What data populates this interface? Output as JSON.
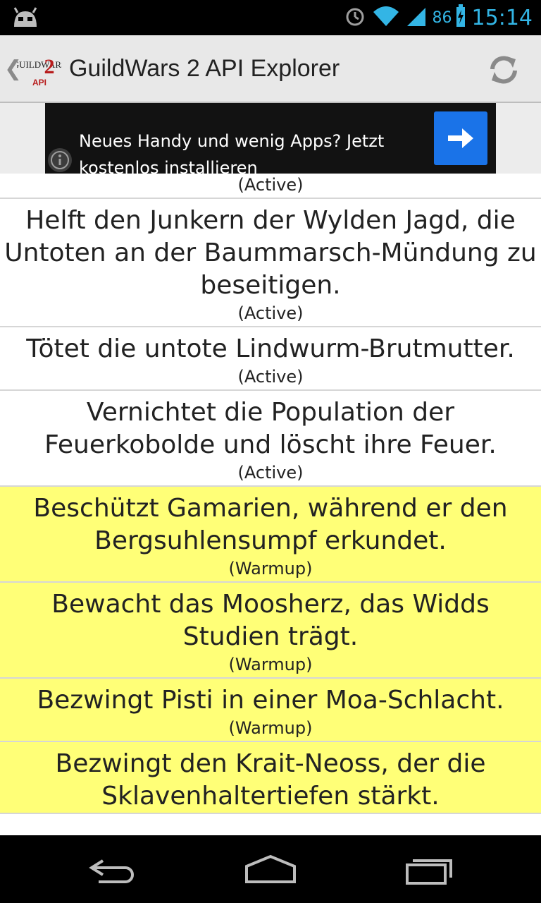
{
  "status_bar": {
    "battery": "86",
    "time": "15:14",
    "icons": [
      "android-robot-icon",
      "alarm-icon",
      "wifi-icon",
      "cell-signal-icon",
      "battery-charging-icon"
    ]
  },
  "action_bar": {
    "title": "GuildWars 2 API Explorer",
    "logo_text": "API",
    "up_icon": "chevron-left-icon",
    "refresh_icon": "refresh-icon"
  },
  "ad": {
    "text_line1": "Neues Handy und wenig Apps? Jetzt",
    "text_line2": "kostenlos installieren",
    "info_icon": "info-icon",
    "arrow_icon": "arrow-right-icon"
  },
  "colors": {
    "accent_blue": "#33b5e5",
    "warmup_bg": "#ffff77",
    "ad_button": "#1a73e8"
  },
  "events": [
    {
      "title": "",
      "status": "(Active)",
      "state": "active",
      "partial": true
    },
    {
      "title": "Helft den Junkern der Wylden Jagd, die Untoten an der Baummarsch-Mündung zu beseitigen.",
      "status": "(Active)",
      "state": "active"
    },
    {
      "title": "Tötet die untote Lindwurm-Brutmutter.",
      "status": "(Active)",
      "state": "active"
    },
    {
      "title": "Vernichtet die Population der Feuerkobolde und löscht ihre Feuer.",
      "status": "(Active)",
      "state": "active"
    },
    {
      "title": "Beschützt Gamarien, während er den Bergsuhlensumpf erkundet.",
      "status": "(Warmup)",
      "state": "warmup"
    },
    {
      "title": "Bewacht das Moosherz, das Widds Studien trägt.",
      "status": "(Warmup)",
      "state": "warmup"
    },
    {
      "title": "Bezwingt Pisti in einer Moa-Schlacht.",
      "status": "(Warmup)",
      "state": "warmup"
    },
    {
      "title": "Bezwingt den Krait-Neoss, der die Sklavenhaltertiefen stärkt.",
      "status": "",
      "state": "warmup"
    }
  ],
  "nav_bar": {
    "icons": [
      "back-icon",
      "home-icon",
      "recent-apps-icon"
    ]
  }
}
